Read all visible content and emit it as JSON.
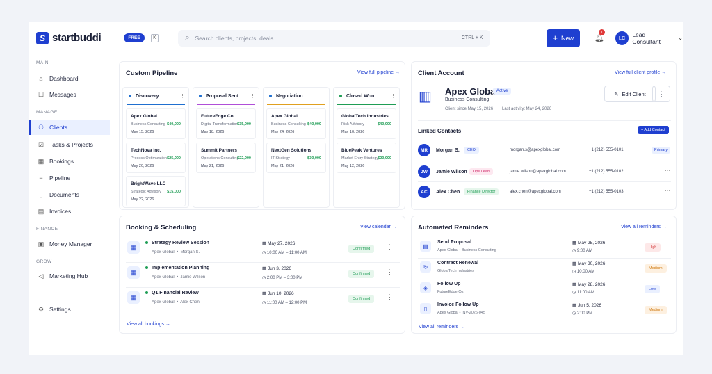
{
  "app": {
    "logo_text": "startbuddi",
    "logo_mark": "S",
    "plan": "FREE",
    "k_key": "K"
  },
  "search": {
    "placeholder": "Search clients, projects, deals...",
    "shortcut": "CTRL + K"
  },
  "new_button": {
    "label": "New",
    "icon": "+"
  },
  "notifications": {
    "count": "1"
  },
  "user": {
    "initials": "LC",
    "name": "Lead Consultant"
  },
  "sidebar": {
    "sections": [
      "MAIN",
      "MANAGE",
      "FINANCE",
      "GROW"
    ],
    "items": [
      {
        "label": "Dashboard",
        "icon": "home-icon"
      },
      {
        "label": "Messages",
        "icon": "chat-icon"
      },
      {
        "label": "Clients",
        "icon": "users-icon",
        "active": true
      },
      {
        "label": "Tasks & Projects",
        "icon": "checkbox-icon"
      },
      {
        "label": "Bookings",
        "icon": "calendar-icon"
      },
      {
        "label": "Pipeline",
        "icon": "pipeline-icon"
      },
      {
        "label": "Documents",
        "icon": "document-icon"
      },
      {
        "label": "Invoices",
        "icon": "invoice-icon"
      },
      {
        "label": "Money Manager",
        "icon": "wallet-icon"
      },
      {
        "label": "Marketing Hub",
        "icon": "megaphone-icon"
      },
      {
        "label": "Settings",
        "icon": "gear-icon"
      }
    ]
  },
  "pipeline": {
    "title": "Custom Pipeline",
    "link": "View full pipeline",
    "columns": [
      {
        "name": "Discovery",
        "color": "#1f6fd0",
        "deals": [
          {
            "name": "Apex Global",
            "desc": "Business Consulting",
            "value": "$40,000",
            "date": "May 15, 2026"
          },
          {
            "name": "TechNova Inc.",
            "desc": "Process Optimization",
            "value": "$25,000",
            "date": "May 20, 2026"
          },
          {
            "name": "BrightWave LLC",
            "desc": "Strategic Advisory",
            "value": "$15,000",
            "date": "May 22, 2026"
          }
        ]
      },
      {
        "name": "Proposal Sent",
        "color": "#b04fd8",
        "deals": [
          {
            "name": "FutureEdge Co.",
            "desc": "Digital Transformation",
            "value": "$35,000",
            "date": "May 18, 2026"
          },
          {
            "name": "Summit Partners",
            "desc": "Operations Consulting",
            "value": "$22,000",
            "date": "May 21, 2026"
          }
        ]
      },
      {
        "name": "Negotiation",
        "color": "#e0a020",
        "deals": [
          {
            "name": "Apex Global",
            "desc": "Business Consulting",
            "value": "$40,000",
            "date": "May 24, 2026"
          },
          {
            "name": "NextGen Solutions",
            "desc": "IT Strategy",
            "value": "$30,000",
            "date": "May 21, 2026"
          }
        ]
      },
      {
        "name": "Closed Won",
        "color": "#1f9d55",
        "deals": [
          {
            "name": "GlobalTech Industries",
            "desc": "Risk Advisory",
            "value": "$40,000",
            "date": "May 10, 2026"
          },
          {
            "name": "BluePeak Ventures",
            "desc": "Market Entry Strategy",
            "value": "$20,000",
            "date": "May 12, 2026"
          }
        ]
      }
    ]
  },
  "client": {
    "title": "Client Account",
    "link": "View full client profile",
    "name": "Apex Global",
    "status": "Active",
    "industry": "Business Consulting",
    "since": "Client since May 15, 2026",
    "activity": "Last activity: May 24, 2026",
    "edit_label": "Edit Client",
    "contacts_title": "Linked Contacts",
    "add_contact": "+ Add Contact",
    "contacts": [
      {
        "initials": "MR",
        "name": "Morgan S.",
        "role": "CEO",
        "role_color": "#1f3fd0",
        "role_bg": "#eaf0ff",
        "email": "morgan.s@apexglobal.com",
        "phone": "+1 (212) 555-0101",
        "primary": "Primary"
      },
      {
        "initials": "JW",
        "name": "Jamie Wilson",
        "role": "Ops Lead",
        "role_color": "#d02a6a",
        "role_bg": "#fde8f0",
        "email": "jamie.wilson@apexglobal.com",
        "phone": "+1 (212) 555-0102"
      },
      {
        "initials": "AC",
        "name": "Alex Chen",
        "role": "Finance Director",
        "role_color": "#1f9d55",
        "role_bg": "#e6f6ec",
        "email": "alex.chen@apexglobal.com",
        "phone": "+1 (212) 555-0103"
      }
    ]
  },
  "booking": {
    "title": "Booking & Scheduling",
    "link": "View calendar",
    "footer_link": "View all bookings",
    "items": [
      {
        "title": "Strategy Review Session",
        "client": "Apex Global",
        "person": "Morgan S.",
        "date": "May 27, 2026",
        "time": "10:00 AM – 11:00 AM",
        "status": "Confirmed"
      },
      {
        "title": "Implementation Planning",
        "client": "Apex Global",
        "person": "Jamie Wilson",
        "date": "Jun 3, 2026",
        "time": "2:00 PM – 3:00 PM",
        "status": "Confirmed"
      },
      {
        "title": "Q1 Financial Review",
        "client": "Apex Global",
        "person": "Alex Chen",
        "date": "Jun 10, 2026",
        "time": "11:00 AM – 12:00 PM",
        "status": "Confirmed"
      }
    ]
  },
  "reminders": {
    "title": "Automated Reminders",
    "link": "View all reminders",
    "footer_link": "View all reminders",
    "items": [
      {
        "title": "Send Proposal",
        "sub": "Apex Global  •  Business Consulting",
        "date": "May 25, 2026",
        "time": "9:00 AM",
        "priority": "High",
        "color": "#d03030",
        "bg": "#fde8e8"
      },
      {
        "title": "Contract Renewal",
        "sub": "GlobalTech Industries",
        "date": "May 30, 2026",
        "time": "10:00 AM",
        "priority": "Medium",
        "color": "#d07a10",
        "bg": "#fdf0e0"
      },
      {
        "title": "Follow Up",
        "sub": "FutureEdge Co.",
        "date": "May 28, 2026",
        "time": "11:00 AM",
        "priority": "Low",
        "color": "#1f3fd0",
        "bg": "#eaf0ff"
      },
      {
        "title": "Invoice Follow Up",
        "sub": "Apex Global  •  INV-2026-045",
        "date": "Jun 5, 2026",
        "time": "2:00 PM",
        "priority": "Medium",
        "color": "#d07a10",
        "bg": "#fdf0e0"
      }
    ]
  }
}
